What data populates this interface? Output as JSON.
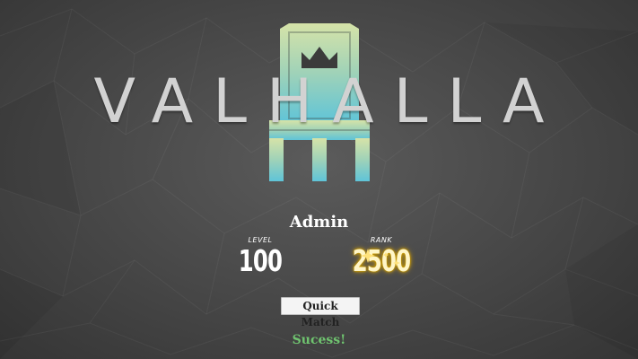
{
  "game": {
    "title": "VALHALLA",
    "logo_icon": "throne-crown-icon"
  },
  "player": {
    "name": "Admin",
    "level_label": "LEVEL",
    "level": "100",
    "rank_label": "RANK",
    "rank": "2500"
  },
  "actions": {
    "quick_match_label": "Quick Match"
  },
  "status": {
    "message": "Sucess!",
    "color": "#6fc36f"
  },
  "colors": {
    "background": "#4a4a4a",
    "logo_text": "#d2d2d2",
    "throne_top": "#d6e3a8",
    "throne_bottom": "#5fc4d8",
    "rank_glow": "#e0b000"
  }
}
